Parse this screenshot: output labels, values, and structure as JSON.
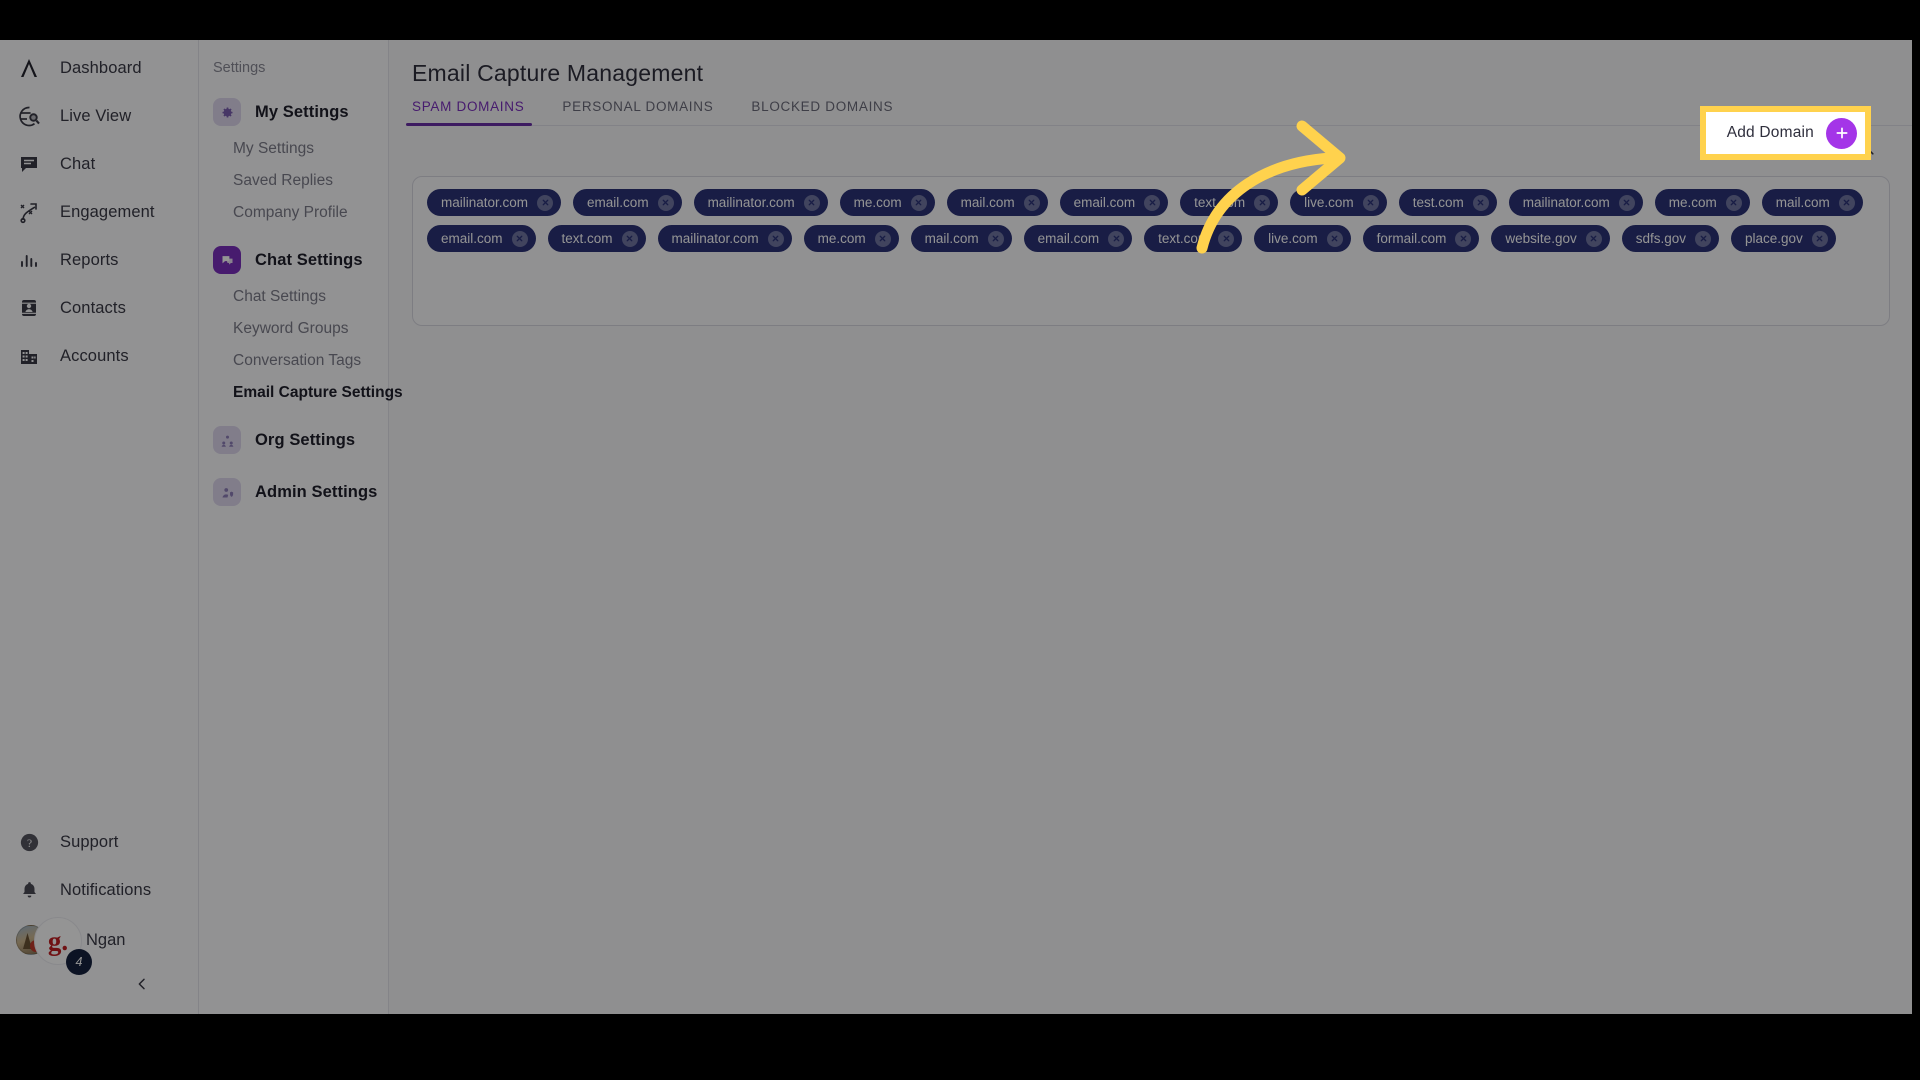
{
  "left_nav": {
    "items": [
      {
        "label": "Dashboard",
        "icon": "logo-peak-icon"
      },
      {
        "label": "Live View",
        "icon": "globe-search-icon"
      },
      {
        "label": "Chat",
        "icon": "chat-bubble-icon"
      },
      {
        "label": "Engagement",
        "icon": "engagement-path-icon"
      },
      {
        "label": "Reports",
        "icon": "bar-chart-icon"
      },
      {
        "label": "Contacts",
        "icon": "contact-card-icon"
      },
      {
        "label": "Accounts",
        "icon": "building-icon"
      }
    ],
    "bottom_items": [
      {
        "label": "Support",
        "icon": "help-circle-icon"
      },
      {
        "label": "Notifications",
        "icon": "bell-icon"
      }
    ],
    "user": {
      "name": "Ngan",
      "badge_letter": "g.",
      "notification_count": "4"
    },
    "collapse_icon": "chevron-left-icon"
  },
  "settings_nav": {
    "caption": "Settings",
    "groups": [
      {
        "label": "My Settings",
        "icon": "gear-icon",
        "icon_style": "lilac",
        "items": [
          {
            "label": "My Settings",
            "active": false
          },
          {
            "label": "Saved Replies",
            "active": false
          },
          {
            "label": "Company Profile",
            "active": false
          }
        ]
      },
      {
        "label": "Chat Settings",
        "icon": "chat-settings-icon",
        "icon_style": "violet",
        "items": [
          {
            "label": "Chat Settings",
            "active": false
          },
          {
            "label": "Keyword Groups",
            "active": false
          },
          {
            "label": "Conversation Tags",
            "active": false
          },
          {
            "label": "Email Capture Settings",
            "active": true
          }
        ]
      },
      {
        "label": "Org Settings",
        "icon": "org-people-icon",
        "icon_style": "pale",
        "items": []
      },
      {
        "label": "Admin Settings",
        "icon": "admin-shield-icon",
        "icon_style": "pale",
        "items": []
      }
    ]
  },
  "main": {
    "title": "Email Capture Management",
    "tabs": [
      {
        "label": "SPAM DOMAINS",
        "active": true
      },
      {
        "label": "PERSONAL DOMAINS",
        "active": false
      },
      {
        "label": "BLOCKED DOMAINS",
        "active": false
      }
    ],
    "search_icon": "search-icon",
    "tags": [
      "mailinator.com",
      "email.com",
      "mailinator.com",
      "me.com",
      "mail.com",
      "email.com",
      "text.com",
      "live.com",
      "test.com",
      "mailinator.com",
      "me.com",
      "mail.com",
      "email.com",
      "text.com",
      "mailinator.com",
      "me.com",
      "mail.com",
      "email.com",
      "text.com",
      "live.com",
      "formail.com",
      "website.gov",
      "sdfs.gov",
      "place.gov"
    ],
    "tag_remove_icon": "close-circle-icon"
  },
  "add_domain": {
    "label": "Add Domain",
    "plus_icon": "plus-icon",
    "highlight_color": "#ffd24d",
    "plus_color": "#a435e8"
  },
  "annotation": {
    "arrow_icon": "curved-arrow-icon",
    "arrow_color": "#ffd24d"
  },
  "theme": {
    "accent": "#7b2fbe",
    "tag_bg": "#2b3377",
    "text_primary": "#2f2f3d",
    "text_muted": "#7d7d8a"
  }
}
